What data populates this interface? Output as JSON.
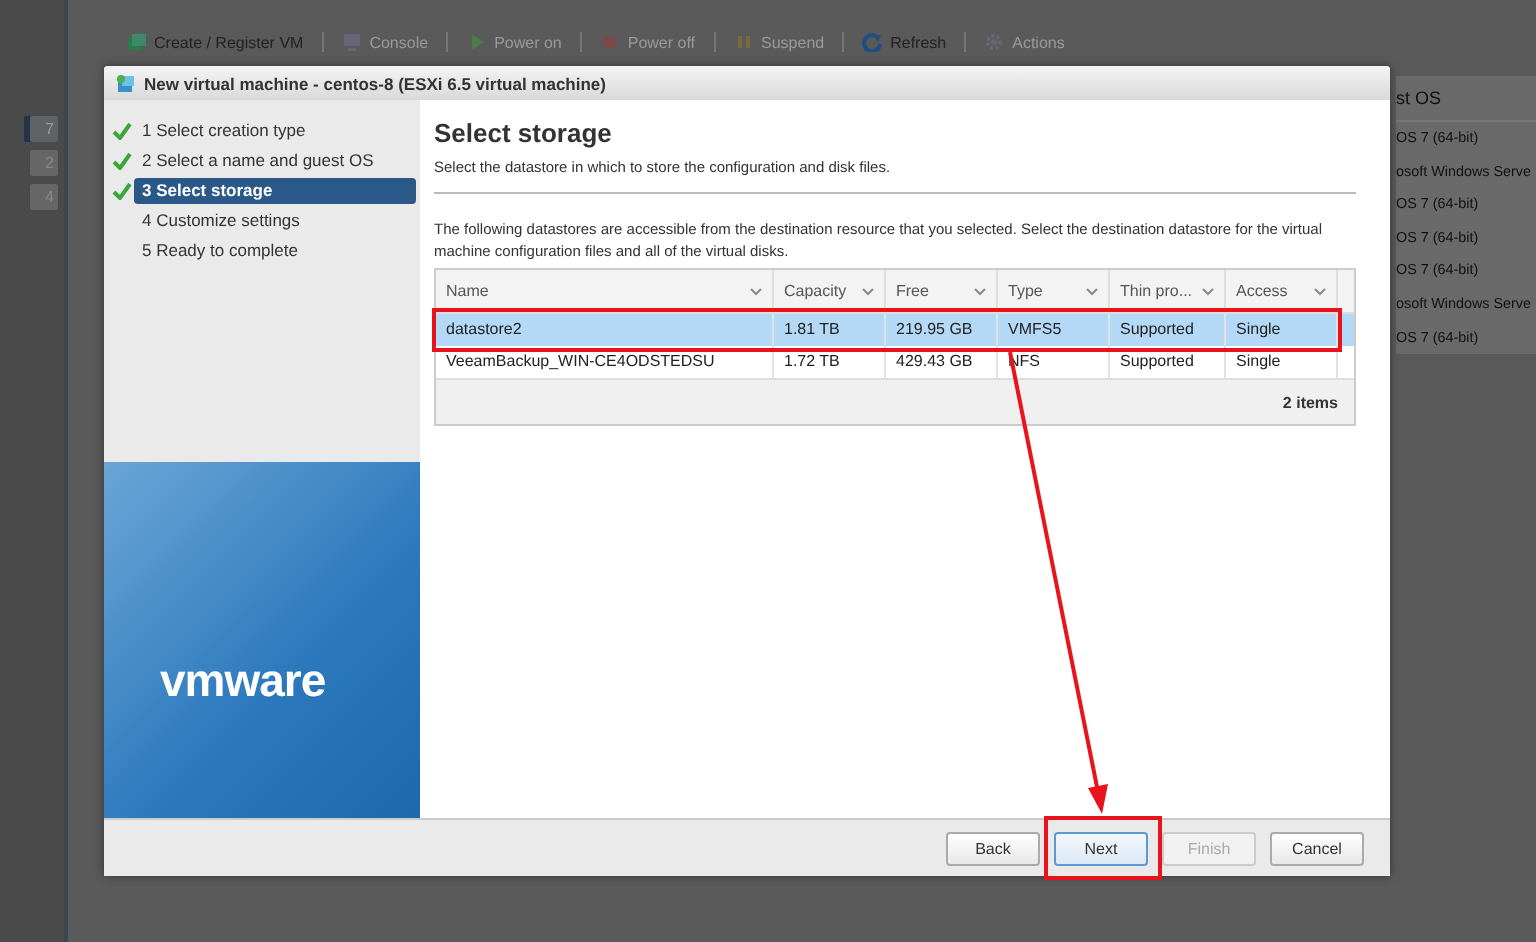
{
  "sidebar_badges": [
    {
      "label": "7",
      "selected": true
    },
    {
      "label": "2",
      "selected": false
    },
    {
      "label": "4",
      "selected": false
    }
  ],
  "toolbar": [
    {
      "kind": "create",
      "label": "Create / Register VM",
      "disabled": false
    },
    {
      "kind": "console",
      "label": "Console",
      "disabled": true
    },
    {
      "kind": "power-on",
      "label": "Power on",
      "disabled": true
    },
    {
      "kind": "power-off",
      "label": "Power off",
      "disabled": true
    },
    {
      "kind": "suspend",
      "label": "Suspend",
      "disabled": true
    },
    {
      "kind": "refresh",
      "label": "Refresh",
      "disabled": false
    },
    {
      "kind": "actions",
      "label": "Actions",
      "disabled": true
    }
  ],
  "background_table": {
    "column": "st OS",
    "rows": [
      "OS 7 (64-bit)",
      "osoft Windows Serve",
      "OS 7 (64-bit)",
      "OS 7 (64-bit)",
      "OS 7 (64-bit)",
      "osoft Windows Serve",
      "OS 7 (64-bit)"
    ]
  },
  "dialog": {
    "title": "New virtual machine - centos-8 (ESXi 6.5 virtual machine)",
    "steps": [
      {
        "label": "1 Select creation type",
        "completed": true,
        "selected": false
      },
      {
        "label": "2 Select a name and guest OS",
        "completed": true,
        "selected": false
      },
      {
        "label": "3 Select storage",
        "completed": true,
        "selected": true
      },
      {
        "label": "4 Customize settings",
        "completed": false,
        "selected": false
      },
      {
        "label": "5 Ready to complete",
        "completed": false,
        "selected": false
      }
    ],
    "logo": "vmware",
    "heading": "Select storage",
    "subtitle": "Select the datastore in which to store the configuration and disk files.",
    "description": "The following datastores are accessible from the destination resource that you selected. Select the destination datastore for the virtual machine configuration files and all of the virtual disks.",
    "table": {
      "columns": [
        "Name",
        "Capacity",
        "Free",
        "Type",
        "Thin pro...",
        "Access"
      ],
      "rows": [
        {
          "cells": [
            "datastore2",
            "1.81 TB",
            "219.95 GB",
            "VMFS5",
            "Supported",
            "Single"
          ],
          "selected": true
        },
        {
          "cells": [
            "VeeamBackup_WIN-CE4ODSTEDSU",
            "1.72 TB",
            "429.43 GB",
            "NFS",
            "Supported",
            "Single"
          ],
          "selected": false
        }
      ],
      "footer": "2 items"
    },
    "buttons": [
      {
        "label": "Back",
        "disabled": false,
        "focused": false
      },
      {
        "label": "Next",
        "disabled": false,
        "focused": true
      },
      {
        "label": "Finish",
        "disabled": true,
        "focused": false
      },
      {
        "label": "Cancel",
        "disabled": false,
        "focused": false
      }
    ]
  }
}
